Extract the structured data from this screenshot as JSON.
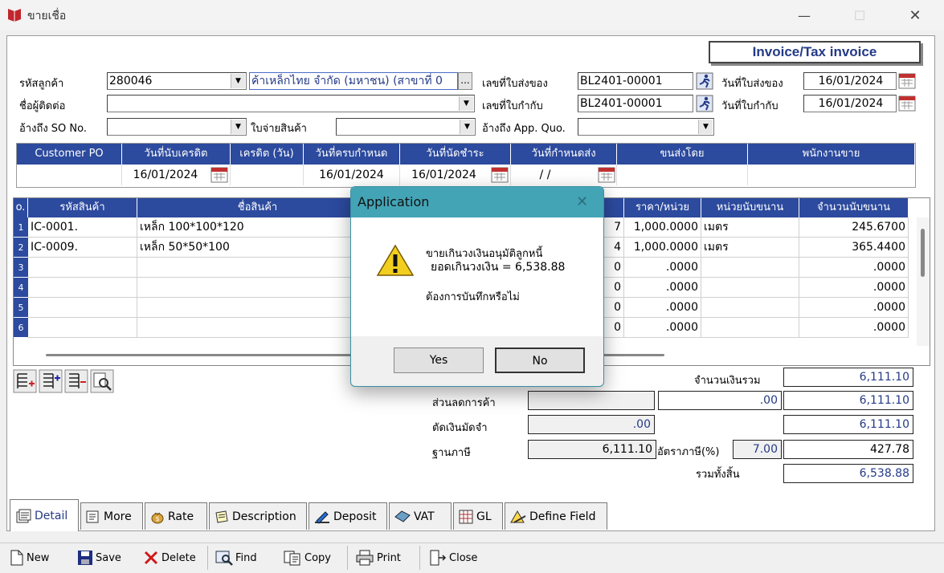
{
  "window": {
    "title": "ขายเชื่อ",
    "minimize": "—",
    "maximize": "☐",
    "close": "✕"
  },
  "header": {
    "invoice_title": "Invoice/Tax invoice",
    "customer_code_label": "รหัสลูกค้า",
    "customer_code": "280046",
    "customer_name": "ค้าเหล็กไทย จำกัด (มหาชน) (สาขาที่ 0",
    "browse_label": "...",
    "contact_label": "ชื่อผู้ติดต่อ",
    "contact_value": "",
    "so_ref_label": "อ้างถึง SO No.",
    "so_ref_value": "",
    "delivery_ref_label": "ใบจ่ายสินค้า",
    "delivery_ref_value": "",
    "delivery_no_label": "เลขที่ใบส่งของ",
    "delivery_no": "BL2401-00001",
    "tax_no_label": "เลขที่ใบกำกับ",
    "tax_no": "BL2401-00001",
    "quo_ref_label": "อ้างถึง App. Quo.",
    "quo_ref_value": "",
    "delivery_date_label": "วันที่ใบส่งของ",
    "delivery_date": "16/01/2024",
    "tax_date_label": "วันที่ใบกำกับ",
    "tax_date": "16/01/2024"
  },
  "terms": {
    "columns": [
      "Customer PO",
      "วันที่นับเครดิต",
      "เครดิต (วัน)",
      "วันที่ครบกำหนด",
      "วันที่นัดชำระ",
      "วันที่กำหนดส่ง",
      "ขนส่งโดย",
      "พนักงานขาย"
    ],
    "values": [
      "",
      "16/01/2024",
      "",
      "16/01/2024",
      "16/01/2024",
      " / /",
      "",
      ""
    ]
  },
  "items": {
    "columns": [
      "o.",
      "รหัสสินค้า",
      "ชื่อสินค้า",
      "ราคา/หน่วย",
      "หน่วยนับขนาน",
      "จำนวนนับขนาน"
    ],
    "rows": [
      {
        "no": "1",
        "code": "IC-0001.",
        "name": "เหล็ก 100*100*120",
        "hidden": "7",
        "price": "1,000.0000",
        "unit": "เมตร",
        "qty": "245.6700"
      },
      {
        "no": "2",
        "code": "IC-0009.",
        "name": "เหล็ก 50*50*100",
        "hidden": "4",
        "price": "1,000.0000",
        "unit": "เมตร",
        "qty": "365.4400"
      },
      {
        "no": "3",
        "code": "",
        "name": "",
        "hidden": "0",
        "price": ".0000",
        "unit": "",
        "qty": ".0000"
      },
      {
        "no": "4",
        "code": "",
        "name": "",
        "hidden": "0",
        "price": ".0000",
        "unit": "",
        "qty": ".0000"
      },
      {
        "no": "5",
        "code": "",
        "name": "",
        "hidden": "0",
        "price": ".0000",
        "unit": "",
        "qty": ".0000"
      },
      {
        "no": "6",
        "code": "",
        "name": "",
        "hidden": "0",
        "price": ".0000",
        "unit": "",
        "qty": ".0000"
      }
    ]
  },
  "totals": {
    "total_label": "จำนวนเงินรวม",
    "total": "6,111.10",
    "discount_label": "ส่วนลดการค้า",
    "discount_amount": ".00",
    "after_discount": "6,111.10",
    "deposit_label": "ตัดเงินมัดจำ",
    "deposit_amount": ".00",
    "after_deposit": "6,111.10",
    "tax_base_label": "ฐานภาษี",
    "tax_base": "6,111.10",
    "vat_rate_label": "อัตราภาษี(%)",
    "vat_rate": "7.00",
    "vat_amount": "427.78",
    "grand_total_label": "รวมทั้งสิ้น",
    "grand_total": "6,538.88"
  },
  "tabs": [
    {
      "label": "Detail",
      "active": true
    },
    {
      "label": "More"
    },
    {
      "label": "Rate"
    },
    {
      "label": "Description"
    },
    {
      "label": "Deposit"
    },
    {
      "label": "VAT"
    },
    {
      "label": "GL"
    },
    {
      "label": "Define Field"
    }
  ],
  "toolbar": {
    "new": "New",
    "save": "Save",
    "delete": "Delete",
    "find": "Find",
    "copy": "Copy",
    "print": "Print",
    "close": "Close"
  },
  "dialog": {
    "title": "Application",
    "line1": "ขายเกินวงเงินอนุมัติลูกหนี้",
    "line2": "ยอดเกินวงเงิน = 6,538.88",
    "line3": "ต้องการบันทึกหรือไม่",
    "yes": "Yes",
    "no": "No",
    "close": "✕"
  },
  "colors": {
    "grid_header": "#2c4a9e",
    "value_text": "#243a86",
    "dialog_title": "#43a4b6"
  }
}
